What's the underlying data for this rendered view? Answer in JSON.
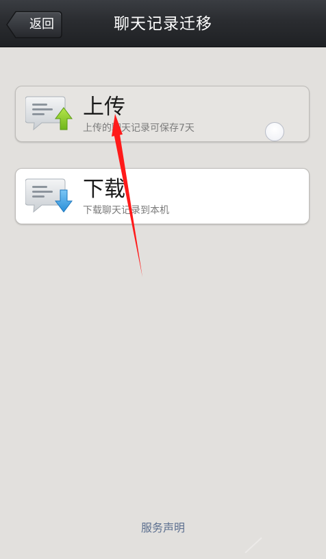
{
  "header": {
    "back_label": "返回",
    "title": "聊天记录迁移"
  },
  "options": [
    {
      "title": "上传",
      "subtitle": "上传的聊天记录可保存7天",
      "icon": "chat-upload-icon",
      "selected": false
    },
    {
      "title": "下载",
      "subtitle": "下载聊天记录到本机",
      "icon": "chat-download-icon"
    }
  ],
  "footer": {
    "link_label": "服务声明"
  },
  "colors": {
    "titlebar": "#2a2c30",
    "background": "#e2e0dd",
    "upload_arrow": "#8fcf2a",
    "download_arrow": "#3aa3e6",
    "link": "#5c6f8f",
    "annotation_arrow": "#ff1a1a"
  }
}
